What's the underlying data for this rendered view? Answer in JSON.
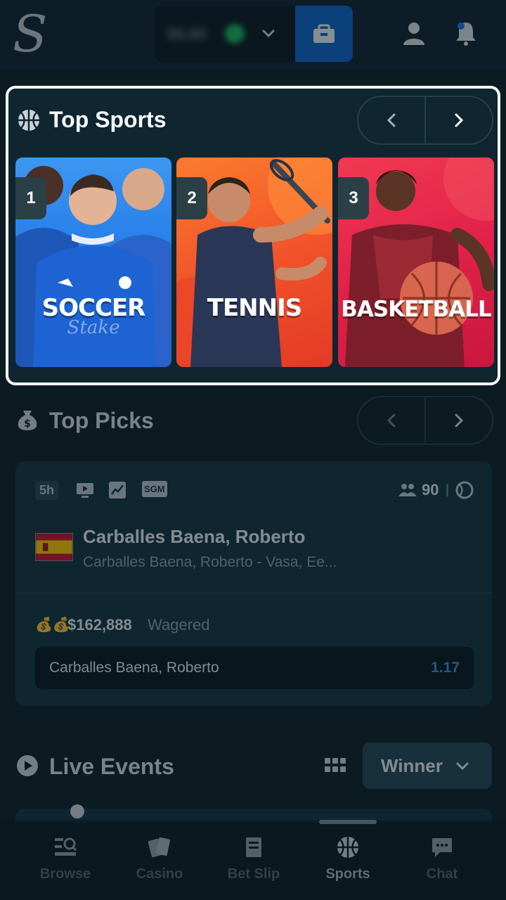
{
  "header": {
    "balance": "$0.00",
    "colors": {
      "wallet": "#0d5fc4",
      "coin": "#17b35c"
    }
  },
  "top_sports": {
    "title": "Top Sports",
    "cards": [
      {
        "rank": "1",
        "name": "SOCCER",
        "color": "#1e74e6"
      },
      {
        "rank": "2",
        "name": "TENNIS",
        "color": "#f0502a"
      },
      {
        "rank": "3",
        "name": "BASKETBALL",
        "color": "#e2214a"
      }
    ]
  },
  "top_picks": {
    "title": "Top Picks",
    "tags": [
      "5h",
      "SGM"
    ],
    "bettors": "90",
    "event_title": "Carballes Baena, Roberto",
    "event_subtitle": "Carballes Baena, Roberto - Vasa, Ee...",
    "wagered_amount": "$162,888",
    "wagered_label": "Wagered",
    "selection": "Carballes Baena, Roberto",
    "odds": "1.17"
  },
  "live_events": {
    "title": "Live Events",
    "market": "Winner"
  },
  "bottom_nav": [
    {
      "label": "Browse",
      "icon": "browse-icon"
    },
    {
      "label": "Casino",
      "icon": "casino-icon"
    },
    {
      "label": "Bet Slip",
      "icon": "bet-slip-icon"
    },
    {
      "label": "Sports",
      "icon": "sports-icon",
      "active": true
    },
    {
      "label": "Chat",
      "icon": "chat-icon"
    }
  ]
}
